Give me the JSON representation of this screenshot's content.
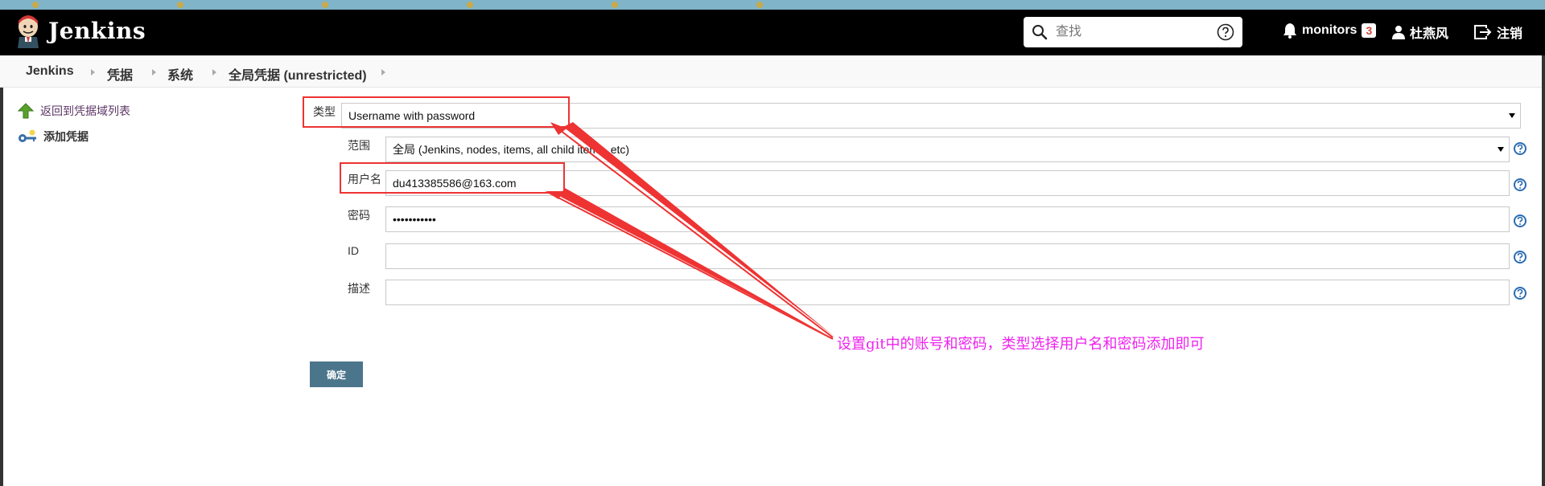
{
  "header": {
    "brand": "Jenkins",
    "search": {
      "placeholder": "查找"
    },
    "monitors": {
      "label": "monitors",
      "count": "3"
    },
    "user": "杜燕风",
    "logout": "注销"
  },
  "breadcrumb": [
    "Jenkins",
    "凭据",
    "系统",
    "全局凭据 (unrestricted)"
  ],
  "sidebar": {
    "items": [
      {
        "label": "返回到凭据域列表",
        "icon": "up-arrow-icon"
      },
      {
        "label": "添加凭据",
        "icon": "key-icon"
      }
    ]
  },
  "form": {
    "kind": {
      "label": "类型",
      "value": "Username with password"
    },
    "scope": {
      "label": "范围",
      "value": "全局 (Jenkins, nodes, items, all child items, etc)"
    },
    "username": {
      "label": "用户名",
      "value": "du413385586@163.com"
    },
    "password": {
      "label": "密码",
      "value": "•••••••••••"
    },
    "id": {
      "label": "ID",
      "value": ""
    },
    "description": {
      "label": "描述",
      "value": ""
    },
    "submit_label": "确定"
  },
  "annotation": "设置git中的账号和密码，类型选择用户名和密码添加即可",
  "colors": {
    "header_bg": "#000000",
    "annotation": "#ee22ee",
    "highlight": "#ee3333",
    "button": "#4b758b",
    "badge_text": "#d24939"
  }
}
